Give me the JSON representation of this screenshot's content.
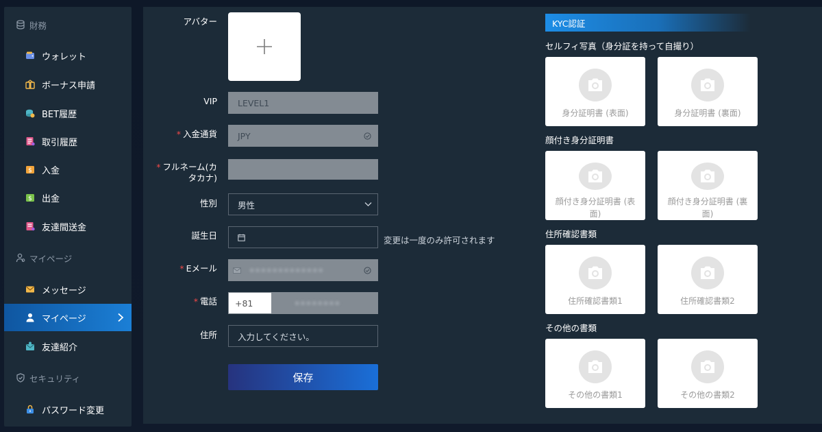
{
  "sidebar": {
    "sections": [
      {
        "label": "財務"
      },
      {
        "label": "マイページ"
      },
      {
        "label": "セキュリティ"
      }
    ],
    "items": [
      {
        "label": "ウォレット"
      },
      {
        "label": "ボーナス申請"
      },
      {
        "label": "BET履歴"
      },
      {
        "label": "取引履歴"
      },
      {
        "label": "入金"
      },
      {
        "label": "出金"
      },
      {
        "label": "友達間送金"
      },
      {
        "label": "メッセージ"
      },
      {
        "label": "マイページ",
        "active": true
      },
      {
        "label": "友達紹介"
      },
      {
        "label": "パスワード変更"
      }
    ]
  },
  "form": {
    "avatar_label": "アバター",
    "vip_label": "VIP",
    "vip_value": "LEVEL1",
    "currency_label": "入金通貨",
    "currency_value": "JPY",
    "fullname_label_1": "フルネーム(カ",
    "fullname_label_2": "タカナ)",
    "gender_label": "性別",
    "gender_value": "男性",
    "birthday_label": "誕生日",
    "birthday_hint": "変更は一度のみ許可されます",
    "email_label": "Eメール",
    "email_value": "•••••••••••••",
    "phone_label": "電話",
    "phone_prefix": "+81",
    "phone_value": "••••••••",
    "address_label": "住所",
    "address_placeholder": "入力してください。",
    "save_label": "保存",
    "required_mark": "*"
  },
  "kyc": {
    "title": "KYC認証",
    "groups": [
      {
        "title": "セルフィ写真（身分証を持って自撮り）",
        "cards": [
          "身分証明書 (表面)",
          "身分証明書 (裏面)"
        ]
      },
      {
        "title": "顔付き身分証明書",
        "cards": [
          "顔付き身分証明書 (表面)",
          "顔付き身分証明書 (裏面)"
        ]
      },
      {
        "title": "住所確認書類",
        "cards": [
          "住所確認書類1",
          "住所確認書類2"
        ]
      },
      {
        "title": "その他の書類",
        "cards": [
          "その他の書類1",
          "その他の書類2"
        ]
      }
    ]
  },
  "colors": {
    "panel": "#1c2b38",
    "accent": "#1b7fd6",
    "required": "#f04848"
  }
}
